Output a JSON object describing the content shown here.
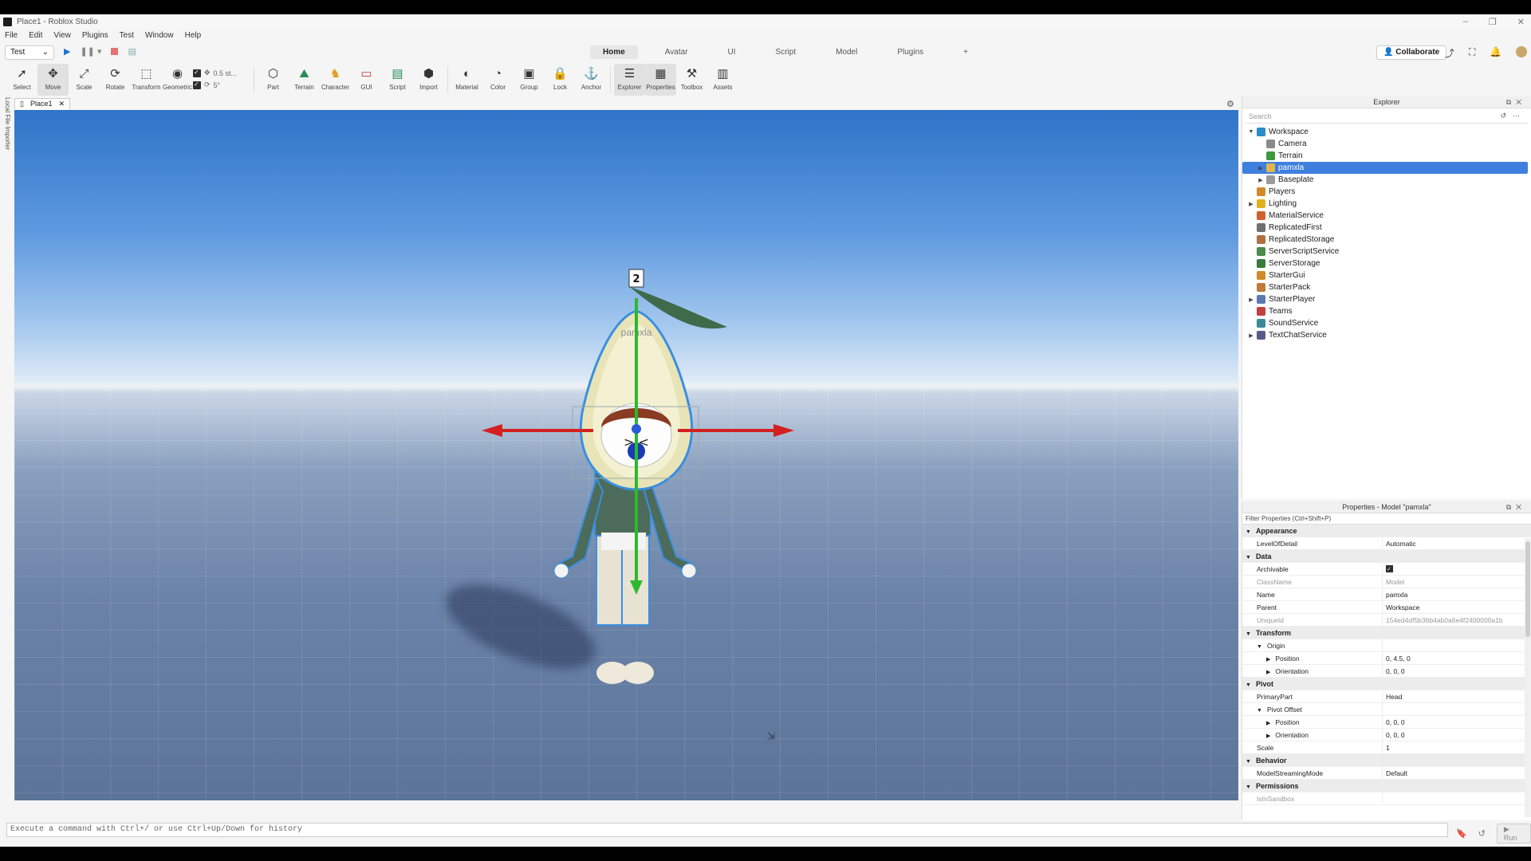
{
  "window": {
    "title": "Place1 - Roblox Studio"
  },
  "menu": [
    "File",
    "Edit",
    "View",
    "Plugins",
    "Test",
    "Window",
    "Help"
  ],
  "test_select": "Test",
  "tabs": [
    "Home",
    "Avatar",
    "UI",
    "Script",
    "Model",
    "Plugins",
    "+"
  ],
  "active_tab": "Home",
  "collaborate_label": "Collaborate",
  "ribbon": {
    "tools": [
      {
        "label": "Select",
        "icon": "cursor-icon"
      },
      {
        "label": "Move",
        "icon": "move-icon"
      },
      {
        "label": "Scale",
        "icon": "scale-icon"
      },
      {
        "label": "Rotate",
        "icon": "rotate-icon"
      },
      {
        "label": "Transform",
        "icon": "transform-icon"
      },
      {
        "label": "Geometric",
        "icon": "geometric-icon"
      }
    ],
    "snap_move": "0.5 st...",
    "snap_rotate": "5°",
    "tools2": [
      {
        "label": "Part",
        "icon": "part-icon"
      },
      {
        "label": "Terrain",
        "icon": "terrain-icon"
      },
      {
        "label": "Character",
        "icon": "character-icon"
      },
      {
        "label": "GUI",
        "icon": "gui-icon"
      },
      {
        "label": "Script",
        "icon": "script-icon"
      },
      {
        "label": "Import",
        "icon": "import-icon"
      }
    ],
    "tools3": [
      {
        "label": "Material",
        "icon": "material-icon"
      },
      {
        "label": "Color",
        "icon": "color-icon"
      },
      {
        "label": "Group",
        "icon": "group-icon"
      },
      {
        "label": "Lock",
        "icon": "lock-icon"
      },
      {
        "label": "Anchor",
        "icon": "anchor-icon"
      }
    ],
    "tools4": [
      {
        "label": "Explorer",
        "icon": "explorer-icon"
      },
      {
        "label": "Properties",
        "icon": "properties-icon"
      },
      {
        "label": "Toolbox",
        "icon": "toolbox-icon"
      },
      {
        "label": "Assets",
        "icon": "assets-icon"
      }
    ]
  },
  "doc_tab": "Place1",
  "side_label": "Local File Importer",
  "viewport": {
    "model_name": "pamxla",
    "handle_label": "2"
  },
  "command_bar": {
    "placeholder": "Execute a command with Ctrl+/ or use Ctrl+Up/Down for history",
    "run_label": "Run"
  },
  "explorer": {
    "title": "Explorer",
    "search_placeholder": "Search",
    "nodes": [
      {
        "label": "Workspace",
        "expanded": true,
        "depth": 0,
        "color": "#2a8ccb"
      },
      {
        "label": "Camera",
        "depth": 1,
        "color": "#8a8a8a"
      },
      {
        "label": "Terrain",
        "depth": 1,
        "color": "#3b9a3b"
      },
      {
        "label": "pamxla",
        "depth": 1,
        "collapsed": true,
        "selected": true,
        "color": "#e0b84a"
      },
      {
        "label": "Baseplate",
        "depth": 1,
        "collapsed": true,
        "color": "#9a9a9a"
      },
      {
        "label": "Players",
        "depth": 0,
        "color": "#d08a2a"
      },
      {
        "label": "Lighting",
        "depth": 0,
        "collapsed": true,
        "color": "#e0b020"
      },
      {
        "label": "MaterialService",
        "depth": 0,
        "color": "#d06030"
      },
      {
        "label": "ReplicatedFirst",
        "depth": 0,
        "color": "#707070"
      },
      {
        "label": "ReplicatedStorage",
        "depth": 0,
        "color": "#b07040"
      },
      {
        "label": "ServerScriptService",
        "depth": 0,
        "color": "#4a8a4a"
      },
      {
        "label": "ServerStorage",
        "depth": 0,
        "color": "#3a7a3a"
      },
      {
        "label": "StarterGui",
        "depth": 0,
        "color": "#d08a2a"
      },
      {
        "label": "StarterPack",
        "depth": 0,
        "color": "#c07a3a"
      },
      {
        "label": "StarterPlayer",
        "depth": 0,
        "collapsed": true,
        "color": "#5a7ab0"
      },
      {
        "label": "Teams",
        "depth": 0,
        "color": "#c04040"
      },
      {
        "label": "SoundService",
        "depth": 0,
        "color": "#3a8a9a"
      },
      {
        "label": "TextChatService",
        "depth": 0,
        "collapsed": true,
        "color": "#5a5a8a"
      }
    ]
  },
  "properties": {
    "title": "Properties - Model \"pamxla\"",
    "filter": "Filter Properties (Ctrl+Shift+P)",
    "rows": [
      {
        "type": "cat",
        "key": "Appearance"
      },
      {
        "key": "LevelOfDetail",
        "value": "Automatic"
      },
      {
        "type": "cat",
        "key": "Data"
      },
      {
        "key": "Archivable",
        "value": "",
        "check": true
      },
      {
        "key": "ClassName",
        "value": "Model",
        "dim": true
      },
      {
        "key": "Name",
        "value": "pamxla"
      },
      {
        "key": "Parent",
        "value": "Workspace"
      },
      {
        "key": "UniqueId",
        "value": "154ed4df5b36b4ab0a6e4f2400000a1b",
        "dim": true
      },
      {
        "type": "cat",
        "key": "Transform"
      },
      {
        "type": "sub",
        "key": "Origin",
        "value": ""
      },
      {
        "type": "sub2",
        "key": "Position",
        "value": "0, 4.5, 0"
      },
      {
        "type": "sub2",
        "key": "Orientation",
        "value": "0, 0, 0"
      },
      {
        "type": "cat",
        "key": "Pivot"
      },
      {
        "key": "PrimaryPart",
        "value": "Head"
      },
      {
        "type": "sub",
        "key": "Pivot Offset",
        "value": ""
      },
      {
        "type": "sub2",
        "key": "Position",
        "value": "0, 0, 0"
      },
      {
        "type": "sub2",
        "key": "Orientation",
        "value": "0, 0, 0"
      },
      {
        "key": "Scale",
        "value": "1"
      },
      {
        "type": "cat",
        "key": "Behavior"
      },
      {
        "key": "ModelStreamingMode",
        "value": "Default"
      },
      {
        "type": "cat",
        "key": "Permissions"
      },
      {
        "key": "IsInSandbox",
        "value": "",
        "dim": true
      }
    ]
  },
  "colors": {
    "accent": "#3f7fe0",
    "move_x": "#d42020",
    "move_y": "#2eb82e"
  }
}
